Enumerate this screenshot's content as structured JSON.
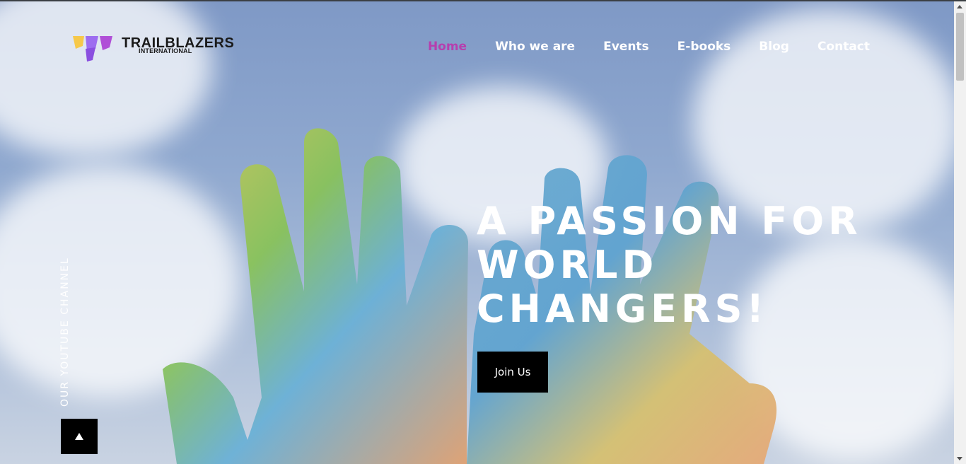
{
  "brand": {
    "name": "TRAILBLAZERS",
    "sub": "INTERNATIONAL"
  },
  "nav": {
    "items": [
      {
        "label": "Home",
        "active": true
      },
      {
        "label": "Who we are",
        "active": false
      },
      {
        "label": "Events",
        "active": false
      },
      {
        "label": "E-books",
        "active": false
      },
      {
        "label": "Blog",
        "active": false
      },
      {
        "label": "Contact",
        "active": false
      }
    ]
  },
  "hero": {
    "headline_lines": [
      "A PASSION FOR",
      "WORLD",
      "CHANGERS!"
    ],
    "cta_label": "Join Us",
    "side_text": "OUR YOUTUBE CHANNEL"
  },
  "icons": {
    "back_to_top": "arrow-up-icon",
    "logo": "trailblazers-logo-icon"
  },
  "colors": {
    "accent": "#b63fae",
    "button_bg": "#000000",
    "text_light": "#ffffff"
  }
}
